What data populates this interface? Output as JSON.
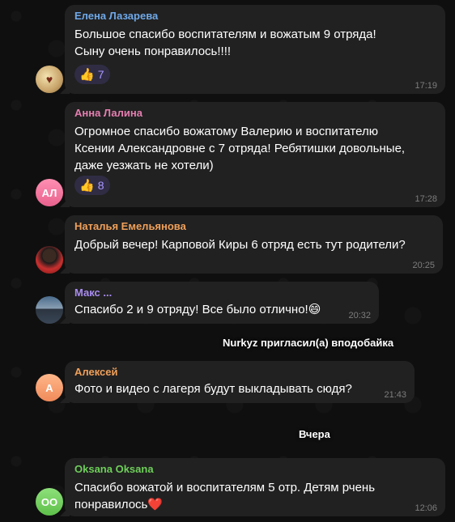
{
  "messages": [
    {
      "author": "Елена Лазарева",
      "author_color": "#6fa8e8",
      "lines": [
        "Большое спасибо воспитателям и вожатым 9 отряда!",
        "Сыну очень понравилось!!!!"
      ],
      "reaction": {
        "icon": "thumbs-up-icon",
        "count": "7"
      },
      "time": "17:19"
    },
    {
      "author": "Анна Лалина",
      "author_color": "#e57fb0",
      "avatar_initials": "АЛ",
      "lines": [
        "Огромное спасибо вожатому Валерию и воспитателю",
        "Ксении Александровне с 7 отряда! Ребятишки довольные,",
        "даже уезжать не хотели)"
      ],
      "reaction": {
        "icon": "thumbs-up-icon",
        "count": "8"
      },
      "time": "17:28"
    },
    {
      "author": "Наталья Емельянова",
      "author_color": "#f0a05a",
      "lines": [
        "Добрый вечер! Карповой Киры 6 отряд есть тут родители?"
      ],
      "time": "20:25"
    },
    {
      "author": "Макс ...",
      "author_color": "#a98df0",
      "lines": [
        "Спасибо 2 и 9 отряду! Все было отлично!😄"
      ],
      "time": "20:32"
    },
    {
      "author": "Алексей",
      "author_color": "#f0a05a",
      "avatar_initials": "А",
      "lines": [
        "Фото и видео с лагеря будут выкладывать сюдя?"
      ],
      "time": "21:43"
    },
    {
      "author": "Oksana Oksana",
      "author_color": "#6ecf5a",
      "avatar_initials": "OO",
      "lines": [
        "Спасибо вожатой и воспитателям 5 отр. Детям рчень",
        "понравилось❤️"
      ],
      "time": "12:06"
    }
  ],
  "service": {
    "invite": "Nurkyz пригласил(а) вподобайка",
    "date": "Вчера"
  },
  "colors": {
    "bubble": "#212121",
    "background": "#0f0f0f"
  }
}
